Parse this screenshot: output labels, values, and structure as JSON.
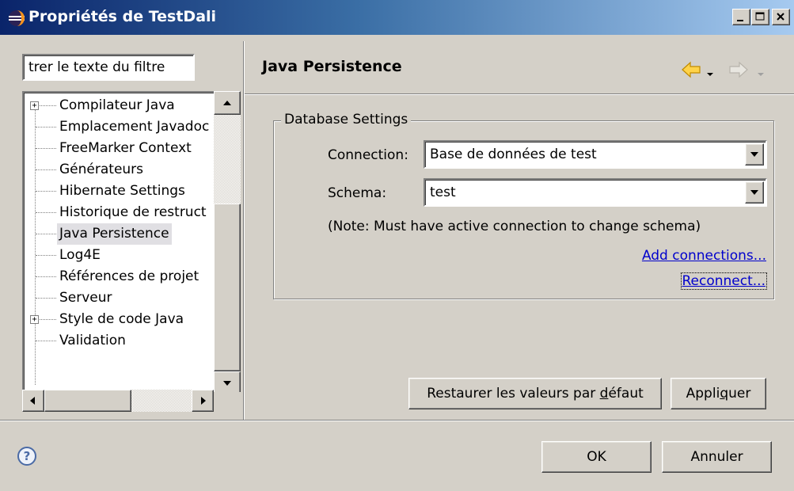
{
  "window": {
    "title": "Propriétés de TestDali",
    "controls": {
      "minimize": "_",
      "maximize": "□",
      "close": "×"
    }
  },
  "filter": {
    "value": "trer le texte du filtre"
  },
  "tree": {
    "items": [
      {
        "label": "Compilateur Java",
        "expandable": true,
        "selected": false
      },
      {
        "label": "Emplacement Javadoc",
        "expandable": false,
        "selected": false
      },
      {
        "label": "FreeMarker Context",
        "expandable": false,
        "selected": false
      },
      {
        "label": "Générateurs",
        "expandable": false,
        "selected": false
      },
      {
        "label": "Hibernate Settings",
        "expandable": false,
        "selected": false
      },
      {
        "label": "Historique de restruct",
        "expandable": false,
        "selected": false
      },
      {
        "label": "Java Persistence",
        "expandable": false,
        "selected": true
      },
      {
        "label": "Log4E",
        "expandable": false,
        "selected": false
      },
      {
        "label": "Références de projet",
        "expandable": false,
        "selected": false
      },
      {
        "label": "Serveur",
        "expandable": false,
        "selected": false
      },
      {
        "label": "Style de code Java",
        "expandable": true,
        "selected": false
      },
      {
        "label": "Validation",
        "expandable": false,
        "selected": false
      }
    ]
  },
  "page": {
    "title": "Java Persistence",
    "nav": {
      "back_icon": "back-arrow-icon",
      "forward_icon": "forward-arrow-icon"
    }
  },
  "database": {
    "legend": "Database Settings",
    "connection_label": "Connection:",
    "connection_value": "Base de données de test",
    "schema_label": "Schema:",
    "schema_value": "test",
    "note": "(Note:  Must have active connection to change schema)",
    "add_connections": "Add connections...",
    "reconnect": "Reconnect..."
  },
  "buttons": {
    "restore_pre": "Restaurer les valeurs par ",
    "restore_mnemonic": "d",
    "restore_post": "éfaut",
    "apply_pre": "Appli",
    "apply_mnemonic": "q",
    "apply_post": "uer",
    "ok": "OK",
    "cancel": "Annuler",
    "help": "?"
  },
  "colors": {
    "title_gradient_start": "#0a246a",
    "title_gradient_end": "#a6caf0",
    "link": "#0000cc",
    "dialog_bg": "#d4d0c8",
    "back_arrow": "#f0b000"
  }
}
